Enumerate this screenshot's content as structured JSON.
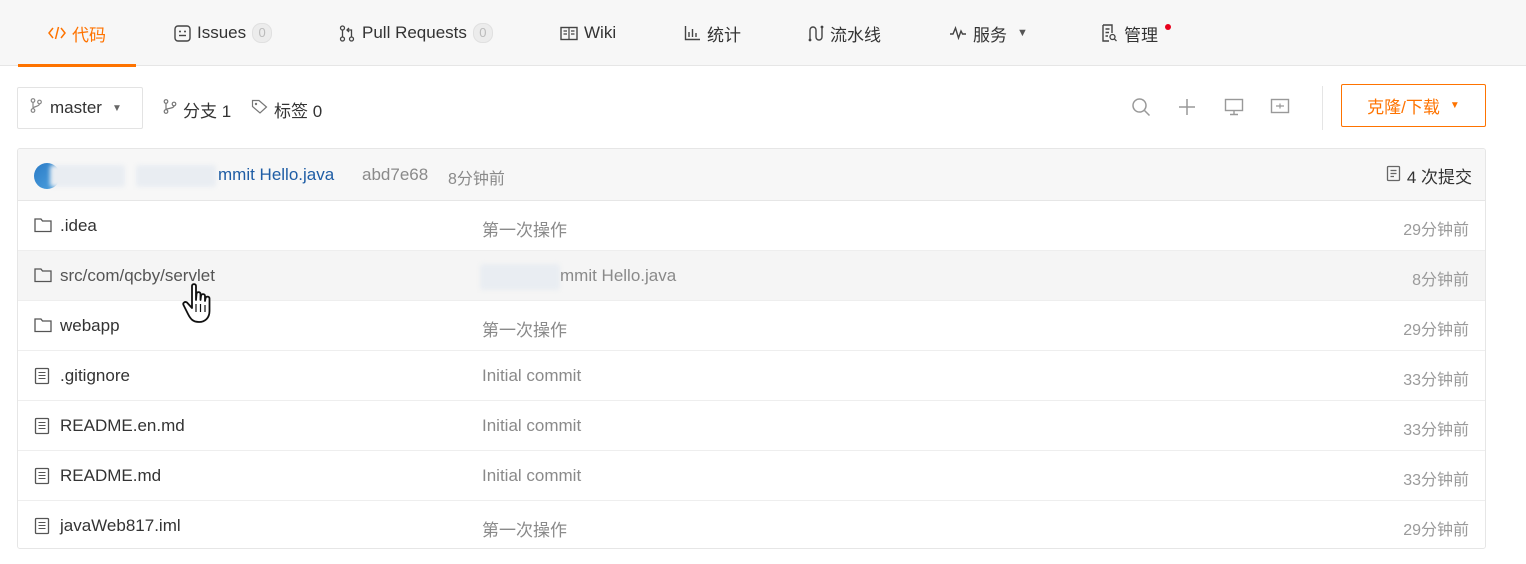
{
  "tabs": [
    {
      "label": "代码",
      "icon": "code-icon",
      "active": true
    },
    {
      "label": "Issues",
      "icon": "issues-icon",
      "count": "0"
    },
    {
      "label": "Pull Requests",
      "icon": "pull-request-icon",
      "count": "0"
    },
    {
      "label": "Wiki",
      "icon": "wiki-icon"
    },
    {
      "label": "统计",
      "icon": "stats-icon"
    },
    {
      "label": "流水线",
      "icon": "pipeline-icon"
    },
    {
      "label": "服务",
      "icon": "service-icon"
    },
    {
      "label": "管理",
      "icon": "manage-icon"
    }
  ],
  "toolbar": {
    "branch": "master",
    "branches_label": "分支 1",
    "tags_label": "标签 0",
    "clone_label": "克隆/下载"
  },
  "latest_commit": {
    "message": "mmit Hello.java",
    "sha": "abd7e68",
    "time": "8分钟前",
    "commit_count": "4 次提交"
  },
  "files": [
    {
      "name": ".idea",
      "type": "folder",
      "message": "第一次操作",
      "time": "29分钟前"
    },
    {
      "name": "src/com/qcby/servlet",
      "type": "folder",
      "message": "mmit Hello.java",
      "time": "8分钟前"
    },
    {
      "name": "webapp",
      "type": "folder",
      "message": "第一次操作",
      "time": "29分钟前"
    },
    {
      "name": ".gitignore",
      "type": "file",
      "message": "Initial commit",
      "time": "33分钟前"
    },
    {
      "name": "README.en.md",
      "type": "file",
      "message": "Initial commit",
      "time": "33分钟前"
    },
    {
      "name": "README.md",
      "type": "file",
      "message": "Initial commit",
      "time": "33分钟前"
    },
    {
      "name": "javaWeb817.iml",
      "type": "file",
      "message": "第一次操作",
      "time": "29分钟前"
    }
  ],
  "colors": {
    "accent": "#fe7300",
    "link": "#1f5da5",
    "notification_dot": "#e8001c"
  }
}
